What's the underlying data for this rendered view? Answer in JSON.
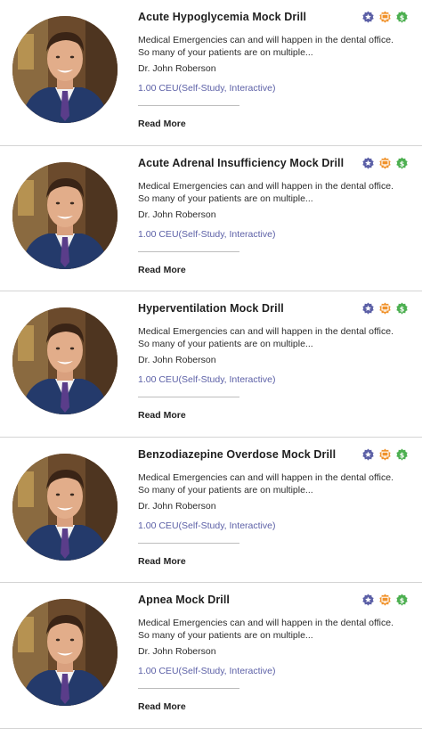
{
  "icons": {
    "star": {
      "name": "star-badge-icon",
      "color": "#5b5fa6"
    },
    "screen": {
      "name": "monitor-badge-icon",
      "color": "#f0922b"
    },
    "dollar": {
      "name": "dollar-badge-icon",
      "color": "#4caf50",
      "glyph": "$"
    }
  },
  "courses": [
    {
      "title": "Acute Hypoglycemia Mock Drill",
      "description": "Medical Emergencies can and will happen in the dental office.  So many of your patients are on multiple...",
      "author": "Dr. John Roberson",
      "ceu": "1.00 CEU(Self-Study, Interactive)",
      "read_more": "Read More"
    },
    {
      "title": "Acute Adrenal Insufficiency Mock Drill",
      "description": "Medical Emergencies can and will happen in the dental office. So many of your patients are on multiple...",
      "author": "Dr. John Roberson",
      "ceu": "1.00 CEU(Self-Study, Interactive)",
      "read_more": "Read More"
    },
    {
      "title": "Hyperventilation Mock Drill",
      "description": "Medical Emergencies can and will happen in the dental office. So many of your patients are on multiple...",
      "author": "Dr. John Roberson",
      "ceu": "1.00 CEU(Self-Study, Interactive)",
      "read_more": "Read More"
    },
    {
      "title": "Benzodiazepine Overdose Mock Drill",
      "description": "Medical Emergencies can and will happen in the dental office. So many of your patients are on multiple...",
      "author": "Dr. John Roberson",
      "ceu": "1.00 CEU(Self-Study, Interactive)",
      "read_more": "Read More"
    },
    {
      "title": "Apnea Mock Drill",
      "description": "Medical Emergencies can and will happen in the dental office. So many of your patients are on multiple...",
      "author": "Dr. John Roberson",
      "ceu": "1.00 CEU(Self-Study, Interactive)",
      "read_more": "Read More"
    }
  ]
}
